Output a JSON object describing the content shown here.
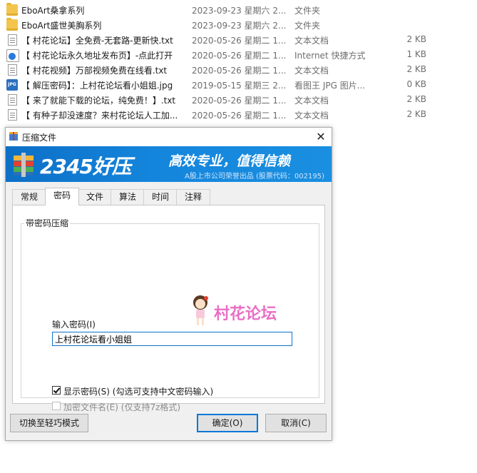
{
  "files": [
    {
      "name": "EboArt桑拿系列",
      "date": "2023-09-23 星期六 2...",
      "type": "文件夹",
      "size": "",
      "icon": "folder-icon"
    },
    {
      "name": "EboArt盛世美胸系列",
      "date": "2023-09-23 星期六 2...",
      "type": "文件夹",
      "size": "",
      "icon": "folder-icon"
    },
    {
      "name": "【 村花论坛】全免费-无套路-更新快.txt",
      "date": "2020-05-26 星期二 1...",
      "type": "文本文档",
      "size": "2 KB",
      "icon": "text-file-icon"
    },
    {
      "name": "【 村花论坛永久地址发布页】-点此打开",
      "date": "2020-05-26 星期二 1...",
      "type": "Internet 快捷方式",
      "size": "1 KB",
      "icon": "internet-shortcut-icon"
    },
    {
      "name": "【 村花视频】万部视频免费在线看.txt",
      "date": "2020-05-26 星期二 1...",
      "type": "文本文档",
      "size": "2 KB",
      "icon": "text-file-icon"
    },
    {
      "name": "【 解压密码】：上村花论坛看小姐姐.jpg",
      "date": "2019-05-15 星期三 2...",
      "type": "看图王 JPG 图片...",
      "size": "0 KB",
      "icon": "jpg-file-icon"
    },
    {
      "name": "【 来了就能下载的论坛，纯免费！】.txt",
      "date": "2020-05-26 星期二 1...",
      "type": "文本文档",
      "size": "2 KB",
      "icon": "text-file-icon"
    },
    {
      "name": "【 有种子却没速度？来村花论坛人工加...",
      "date": "2020-05-26 星期二 1...",
      "type": "文本文档",
      "size": "2 KB",
      "icon": "text-file-icon"
    }
  ],
  "dialog": {
    "title": "压缩文件",
    "close_glyph": "✕",
    "banner": {
      "brand": "2345好压",
      "slogan": "高效专业，值得信赖",
      "subtitle": "A股上市公司荣誉出品 (股票代码：002195)"
    },
    "tabs": [
      "常规",
      "密码",
      "文件",
      "算法",
      "时间",
      "注释"
    ],
    "active_tab": "密码",
    "group_title": "带密码压缩",
    "password_label": "输入密码(I)",
    "password_value": "上村花论坛看小姐姐",
    "forum_logo_text": "村花论坛",
    "show_password_label": "显示密码(S) (勾选可支持中文密码输入)",
    "show_password_checked": true,
    "encrypt_names_label": "加密文件名(E) (仅支持7z格式)",
    "encrypt_names_checked": false,
    "buttons": {
      "switch_mode": "切换至轻巧模式",
      "ok": "确定(O)",
      "cancel": "取消(C)"
    }
  },
  "colors": {
    "banner": "#1485dc",
    "focus_border": "#0078d7",
    "forum_pink": "#e96fc6"
  }
}
